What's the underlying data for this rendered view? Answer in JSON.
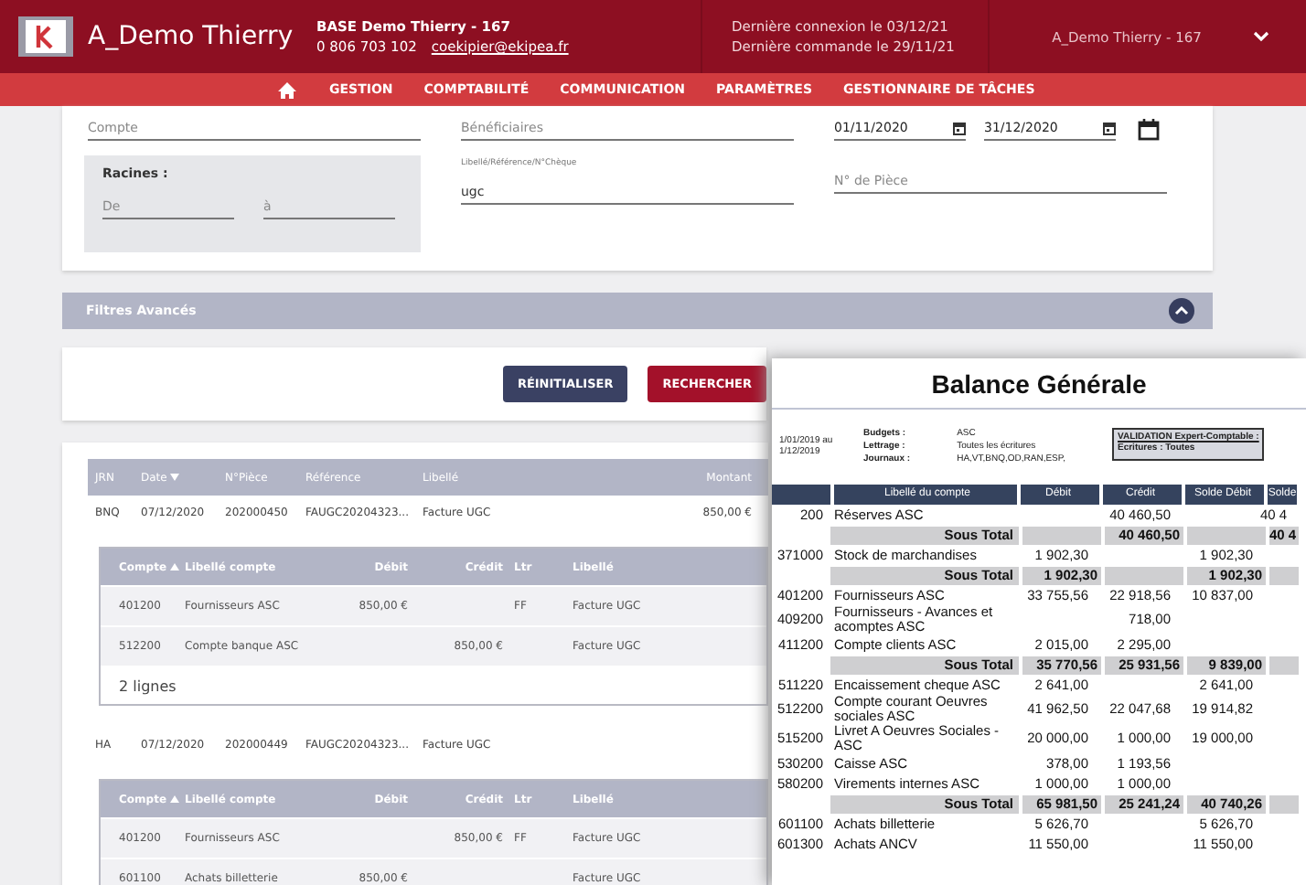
{
  "header": {
    "app_title": "A_Demo Thierry",
    "base": "BASE Demo Thierry - 167",
    "phone": "0 806 703 102",
    "email": "coekipier@ekipea.fr",
    "last_login": "Dernière connexion le 03/12/21",
    "last_order": "Dernière commande le 29/11/21",
    "user": "A_Demo Thierry - 167"
  },
  "nav": {
    "items": [
      "GESTION",
      "COMPTABILITÉ",
      "COMMUNICATION",
      "PARAMÈTRES",
      "GESTIONNAIRE DE TÂCHES"
    ]
  },
  "filters": {
    "compte": {
      "placeholder": "Compte"
    },
    "beneficiaires": {
      "placeholder": "Bénéficiaires"
    },
    "date_from": {
      "value": "01/11/2020"
    },
    "date_to": {
      "value": "31/12/2020"
    },
    "racines": {
      "label": "Racines :",
      "from": {
        "placeholder": "De"
      },
      "to": {
        "placeholder": "à"
      }
    },
    "libelle": {
      "label": "Libellé/Référence/N°Chèque",
      "value": "ugc"
    },
    "piece": {
      "placeholder": "N° de Pièce"
    }
  },
  "advanced_filters": {
    "label": "Filtres Avancés",
    "expanded": true
  },
  "buttons": [
    "RÉINITIALISER",
    "RECHERCHER"
  ],
  "table": {
    "columns": [
      "JRN",
      "Date",
      "N°Pièce",
      "Référence",
      "Libellé",
      "Montant"
    ],
    "entries": [
      {
        "jrn": "BNQ",
        "date": "07/12/2020",
        "piece": "202000450",
        "reference": "FAUGC20204323...",
        "libelle": "Facture UGC",
        "montant": "850,00 €",
        "expanded": true,
        "footer": "2 lignes",
        "columns": [
          "Compte",
          "Libellé compte",
          "Débit",
          "Crédit",
          "Ltr",
          "Libellé"
        ],
        "lines": [
          {
            "compte": "401200",
            "libelle_compte": "Fournisseurs ASC",
            "debit": "850,00 €",
            "ltr": "FF",
            "libelle": "Facture UGC"
          },
          {
            "compte": "512200",
            "libelle_compte": "Compte banque ASC",
            "credit": "850,00 €",
            "libelle": "Facture UGC"
          }
        ]
      },
      {
        "jrn": "HA",
        "date": "07/12/2020",
        "piece": "202000449",
        "reference": "FAUGC20204323...",
        "libelle": "Facture UGC",
        "expanded": true,
        "columns": [
          "Compte",
          "Libellé compte",
          "Débit",
          "Crédit",
          "Ltr",
          "Libellé"
        ],
        "lines": [
          {
            "compte": "401200",
            "libelle_compte": "Fournisseurs ASC",
            "credit": "850,00 €",
            "ltr": "FF",
            "libelle": "Facture UGC"
          },
          {
            "compte": "601100",
            "libelle_compte": "Achats billetterie",
            "debit": "850,00 €",
            "libelle": "Facture UGC"
          }
        ]
      }
    ]
  },
  "report": {
    "title": "Balance Générale",
    "period": [
      "1/01/2019 au",
      "1/12/2019"
    ],
    "meta": [
      {
        "label": "Budgets :",
        "value": "ASC"
      },
      {
        "label": "Lettrage :",
        "value": "Toutes les écritures"
      },
      {
        "label": "Journaux :",
        "value": "HA,VT,BNQ,OD,RAN,ESP,"
      }
    ],
    "validation": [
      "VALIDATION Expert-Comptable :",
      "Ecritures : Toutes"
    ],
    "columns": [
      "Libellé du compte",
      "Débit",
      "Crédit",
      "Solde Débit",
      "Solde"
    ],
    "rows": [
      {
        "kind": "line",
        "account": "200",
        "label": "Réserves ASC",
        "credit": "40 460,50",
        "solde": "40 4"
      },
      {
        "kind": "subtotal",
        "label": "Sous Total",
        "credit": "40 460,50",
        "solde": "40 4"
      },
      {
        "kind": "line",
        "account": "371000",
        "label": "Stock de marchandises",
        "debit": "1 902,30",
        "solde_debit": "1 902,30"
      },
      {
        "kind": "subtotal",
        "label": "Sous Total",
        "debit": "1 902,30",
        "solde_debit": "1 902,30"
      },
      {
        "kind": "line",
        "account": "401200",
        "label": "Fournisseurs ASC",
        "debit": "33 755,56",
        "credit": "22 918,56",
        "solde_debit": "10 837,00"
      },
      {
        "kind": "line",
        "account": "409200",
        "label": "Fournisseurs - Avances et acomptes ASC",
        "credit": "718,00"
      },
      {
        "kind": "line",
        "account": "411200",
        "label": "Compte clients ASC",
        "debit": "2 015,00",
        "credit": "2 295,00"
      },
      {
        "kind": "subtotal",
        "label": "Sous Total",
        "debit": "35 770,56",
        "credit": "25 931,56",
        "solde_debit": "9 839,00"
      },
      {
        "kind": "line",
        "account": "511220",
        "label": "Encaissement cheque ASC",
        "debit": "2 641,00",
        "solde_debit": "2 641,00"
      },
      {
        "kind": "line",
        "account": "512200",
        "label": "Compte courant Oeuvres sociales ASC",
        "debit": "41 962,50",
        "credit": "22 047,68",
        "solde_debit": "19 914,82"
      },
      {
        "kind": "line",
        "account": "515200",
        "label": "Livret A Oeuvres Sociales - ASC",
        "debit": "20 000,00",
        "credit": "1 000,00",
        "solde_debit": "19 000,00"
      },
      {
        "kind": "line",
        "account": "530200",
        "label": "Caisse ASC",
        "debit": "378,00",
        "credit": "1 193,56"
      },
      {
        "kind": "line",
        "account": "580200",
        "label": "Virements internes ASC",
        "debit": "1 000,00",
        "credit": "1 000,00"
      },
      {
        "kind": "subtotal",
        "label": "Sous Total",
        "debit": "65 981,50",
        "credit": "25 241,24",
        "solde_debit": "40 740,26"
      },
      {
        "kind": "line",
        "account": "601100",
        "label": "Achats billetterie",
        "debit": "5 626,70",
        "solde_debit": "5 626,70"
      },
      {
        "kind": "line",
        "account": "601300",
        "label": "Achats ANCV",
        "debit": "11 550,00",
        "solde_debit": "11 550,00"
      }
    ]
  }
}
